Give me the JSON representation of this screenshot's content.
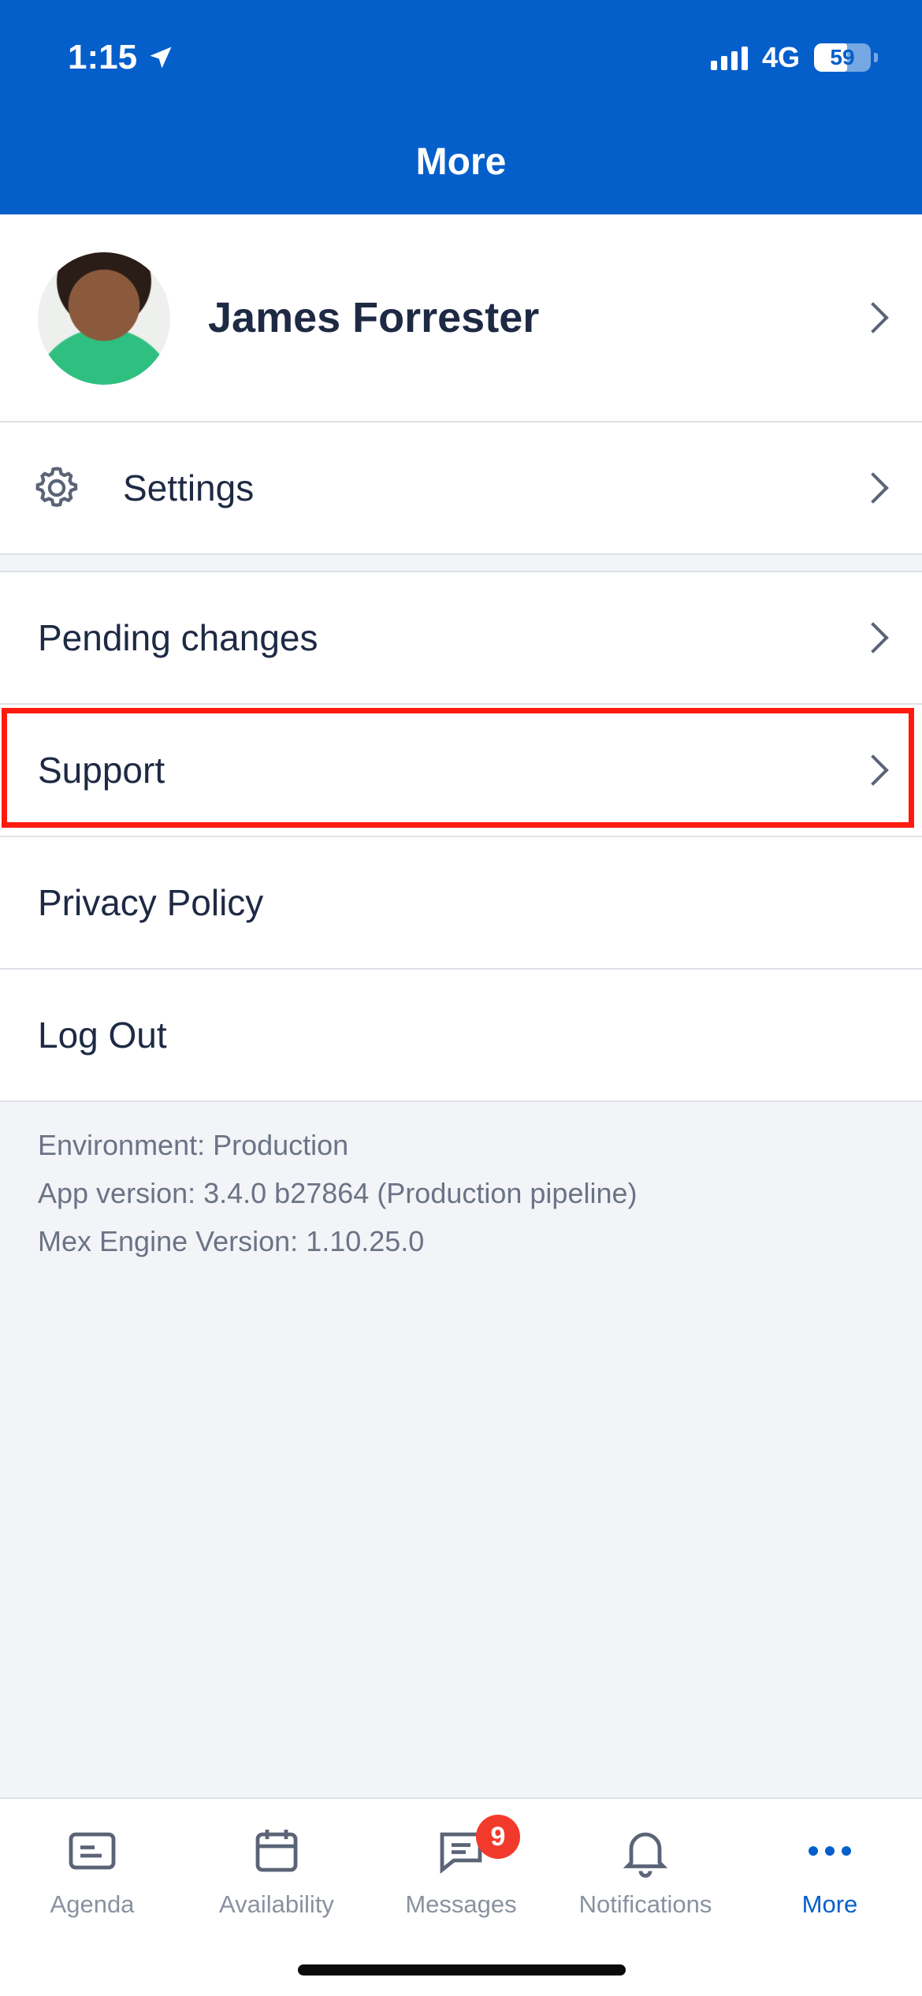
{
  "status_bar": {
    "time": "1:15",
    "network": "4G",
    "battery": "59",
    "battery_level": 0.59
  },
  "header": {
    "title": "More"
  },
  "profile": {
    "name": "James Forrester"
  },
  "menu": {
    "settings": "Settings",
    "pending_changes": "Pending changes",
    "support": "Support",
    "privacy_policy": "Privacy Policy",
    "log_out": "Log Out"
  },
  "info": {
    "environment": "Environment: Production",
    "app_version": "App version: 3.4.0 b27864 (Production pipeline)",
    "engine_version": "Mex Engine Version: 1.10.25.0"
  },
  "tabs": [
    {
      "label": "Agenda",
      "icon": "agenda-icon"
    },
    {
      "label": "Availability",
      "icon": "calendar-icon"
    },
    {
      "label": "Messages",
      "icon": "message-icon",
      "badge": "9"
    },
    {
      "label": "Notifications",
      "icon": "bell-icon"
    },
    {
      "label": "More",
      "icon": "more-dots-icon",
      "active": true
    }
  ],
  "colors": {
    "brand": "#055fca",
    "highlight": "#ff1a0f",
    "badge": "#f23a2c"
  }
}
